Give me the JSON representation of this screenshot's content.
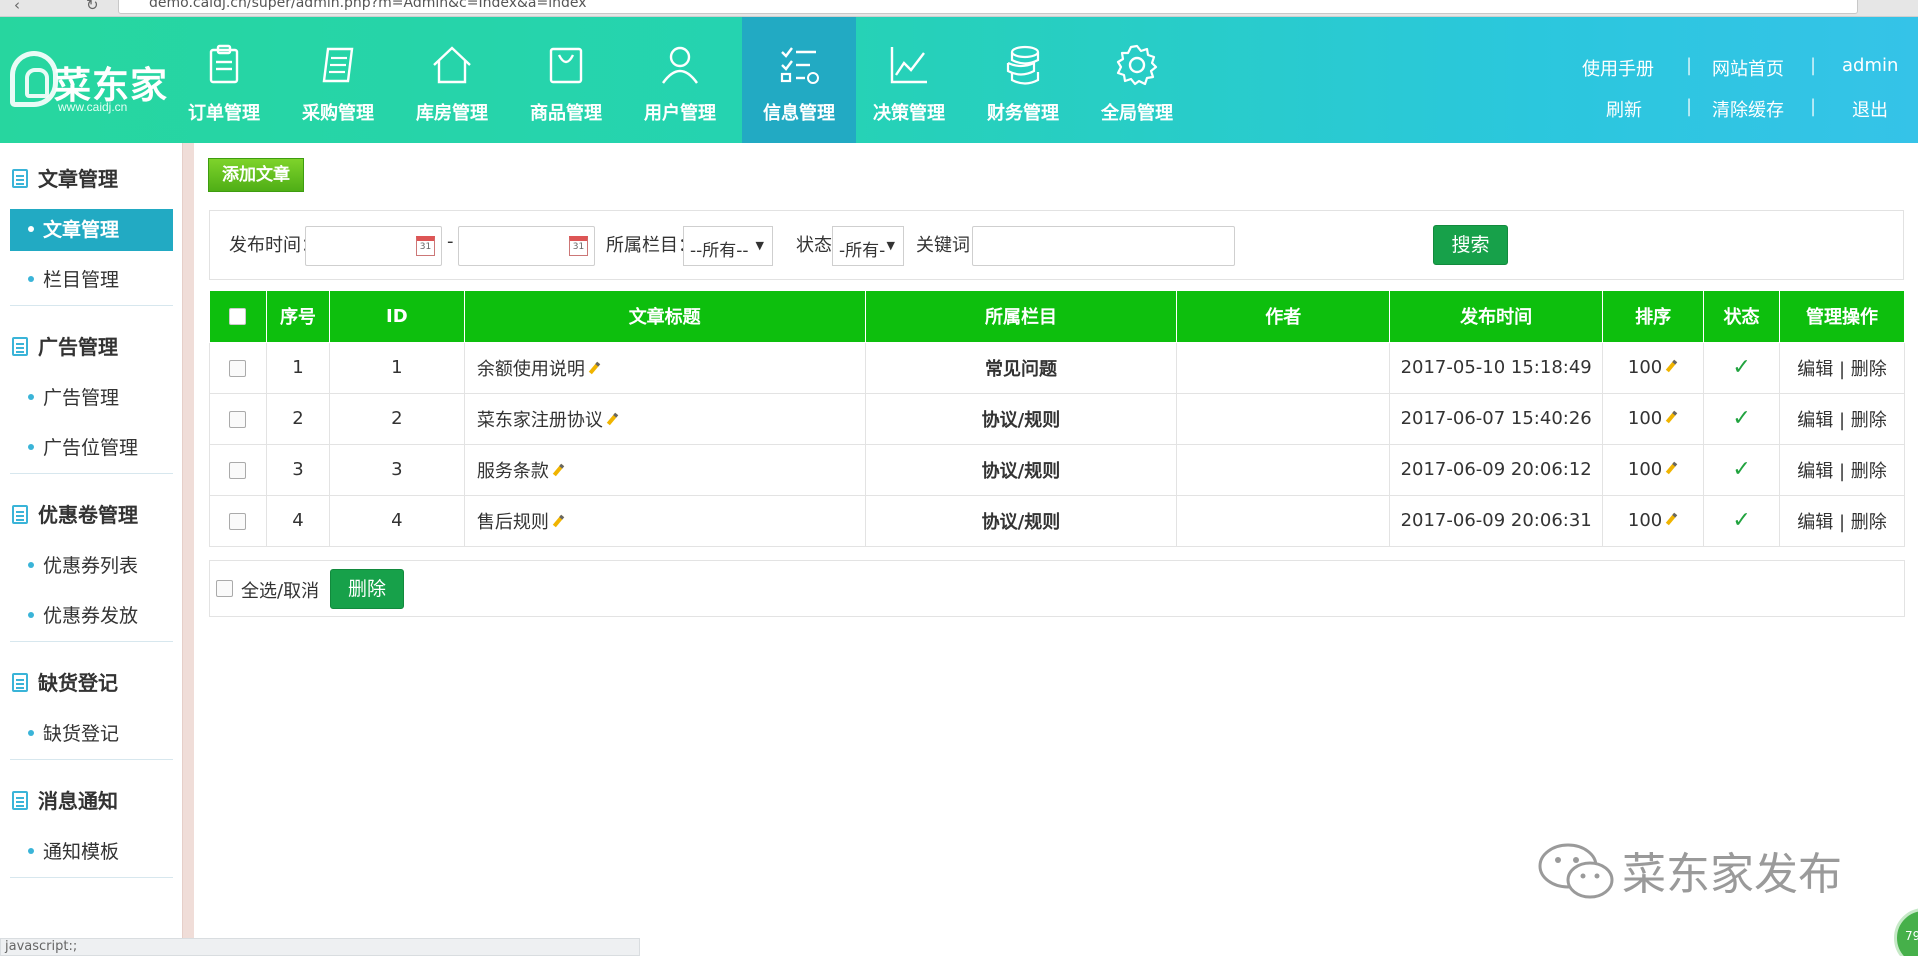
{
  "browser": {
    "url": "demo.caidj.cn/super/admin.php?m=Admin&c=Index&a=index"
  },
  "brand": {
    "name": "菜东家",
    "url": "www.caidj.cn"
  },
  "nav": [
    {
      "label": "订单管理",
      "icon": "clipboard-icon"
    },
    {
      "label": "采购管理",
      "icon": "list-book-icon"
    },
    {
      "label": "库房管理",
      "icon": "house-icon"
    },
    {
      "label": "商品管理",
      "icon": "shopping-bag-icon"
    },
    {
      "label": "用户管理",
      "icon": "user-icon"
    },
    {
      "label": "信息管理",
      "icon": "checklist-icon",
      "active": true
    },
    {
      "label": "决策管理",
      "icon": "line-chart-icon"
    },
    {
      "label": "财务管理",
      "icon": "coins-icon"
    },
    {
      "label": "全局管理",
      "icon": "gear-icon"
    }
  ],
  "toplinks": {
    "manual": "使用手册",
    "homepage": "网站首页",
    "user": "admin",
    "refresh": "刷新",
    "clear_cache": "清除缓存",
    "logout": "退出",
    "sep": "|"
  },
  "sidebar": {
    "sections": [
      {
        "title": "文章管理",
        "items": [
          "文章管理",
          "栏目管理"
        ]
      },
      {
        "title": "广告管理",
        "items": [
          "广告管理",
          "广告位管理"
        ]
      },
      {
        "title": "优惠卷管理",
        "items": [
          "优惠券列表",
          "优惠券发放"
        ]
      },
      {
        "title": "缺货登记",
        "items": [
          "缺货登记"
        ]
      },
      {
        "title": "消息通知",
        "items": [
          "通知模板"
        ]
      }
    ]
  },
  "main": {
    "add_button": "添加文章",
    "filter": {
      "publish_time_label": "发布时间：",
      "range_dash": "-",
      "calendar_glyph": "31",
      "column_label": "所属栏目：",
      "column_value": "--所有--",
      "status_label": "状态:",
      "status_value": "-所有-",
      "keyword_label": "关键词：",
      "search_button": "搜索"
    },
    "table": {
      "headers": [
        "",
        "序号",
        "ID",
        "文章标题",
        "所属栏目",
        "作者",
        "发布时间",
        "排序",
        "状态",
        "管理操作"
      ],
      "rows": [
        {
          "no": "1",
          "id": "1",
          "title": "余额使用说明",
          "column": "常见问题",
          "author": "",
          "time": "2017-05-10 15:18:49",
          "sort": "100",
          "status": "✓",
          "edit": "编辑",
          "delete": "删除"
        },
        {
          "no": "2",
          "id": "2",
          "title": "菜东家注册协议",
          "column": "协议/规则",
          "author": "",
          "time": "2017-06-07 15:40:26",
          "sort": "100",
          "status": "✓",
          "edit": "编辑",
          "delete": "删除"
        },
        {
          "no": "3",
          "id": "3",
          "title": "服务条款",
          "column": "协议/规则",
          "author": "",
          "time": "2017-06-09 20:06:12",
          "sort": "100",
          "status": "✓",
          "edit": "编辑",
          "delete": "删除"
        },
        {
          "no": "4",
          "id": "4",
          "title": "售后规则",
          "column": "协议/规则",
          "author": "",
          "time": "2017-06-09 20:06:31",
          "sort": "100",
          "status": "✓",
          "edit": "编辑",
          "delete": "删除"
        }
      ]
    },
    "select_all": "全选/取消",
    "delete_button": "删除"
  },
  "watermark": "菜东家发布",
  "statusbar": "javascript:;",
  "badge": "79",
  "colors": {
    "header_start": "#27d69f",
    "header_end": "#35c3e8",
    "active": "#22aac3",
    "table_head": "#0dbf0d",
    "button_green": "#17a14a"
  }
}
